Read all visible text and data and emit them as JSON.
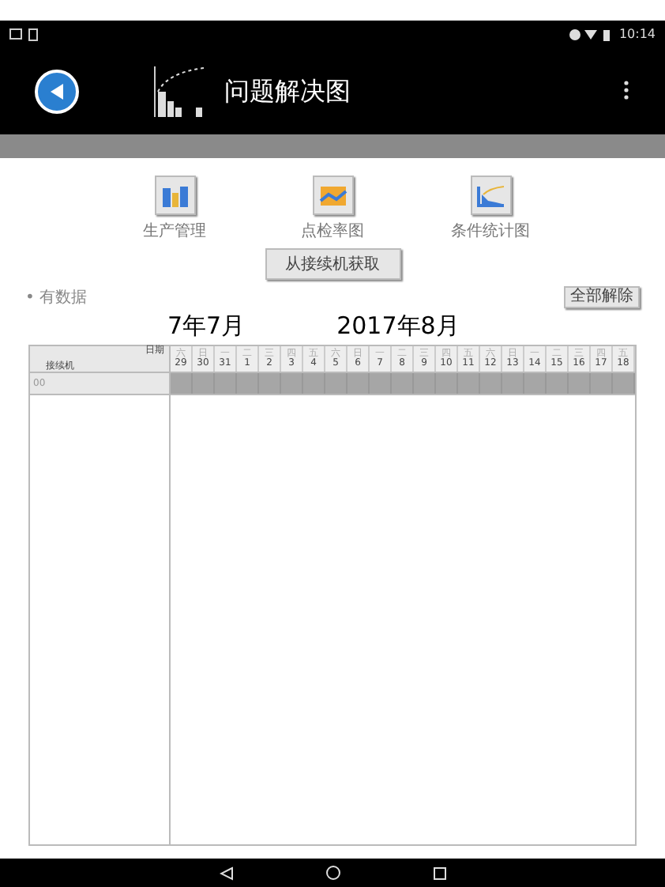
{
  "status_bar": {
    "time": "10:14"
  },
  "app_bar": {
    "title": "问题解决图"
  },
  "tools": [
    {
      "label": "生产管理"
    },
    {
      "label": "点检率图"
    },
    {
      "label": "条件统计图"
    }
  ],
  "fetch_button": "从接续机获取",
  "filter_label": "• 有数据",
  "clear_button": "全部解除",
  "months": [
    "7年7月",
    "2017年8月"
  ],
  "table": {
    "corner_top": "日期",
    "corner_bottom": "接续机",
    "days": [
      {
        "weekday": "六",
        "day": "29"
      },
      {
        "weekday": "日",
        "day": "30"
      },
      {
        "weekday": "一",
        "day": "31"
      },
      {
        "weekday": "二",
        "day": "1"
      },
      {
        "weekday": "三",
        "day": "2"
      },
      {
        "weekday": "四",
        "day": "3"
      },
      {
        "weekday": "五",
        "day": "4"
      },
      {
        "weekday": "六",
        "day": "5"
      },
      {
        "weekday": "日",
        "day": "6"
      },
      {
        "weekday": "一",
        "day": "7"
      },
      {
        "weekday": "二",
        "day": "8"
      },
      {
        "weekday": "三",
        "day": "9"
      },
      {
        "weekday": "四",
        "day": "10"
      },
      {
        "weekday": "五",
        "day": "11"
      },
      {
        "weekday": "六",
        "day": "12"
      },
      {
        "weekday": "日",
        "day": "13"
      },
      {
        "weekday": "一",
        "day": "14"
      },
      {
        "weekday": "二",
        "day": "15"
      },
      {
        "weekday": "三",
        "day": "16"
      },
      {
        "weekday": "四",
        "day": "17"
      },
      {
        "weekday": "五",
        "day": "18"
      }
    ],
    "rows": [
      {
        "label": "00"
      }
    ]
  }
}
